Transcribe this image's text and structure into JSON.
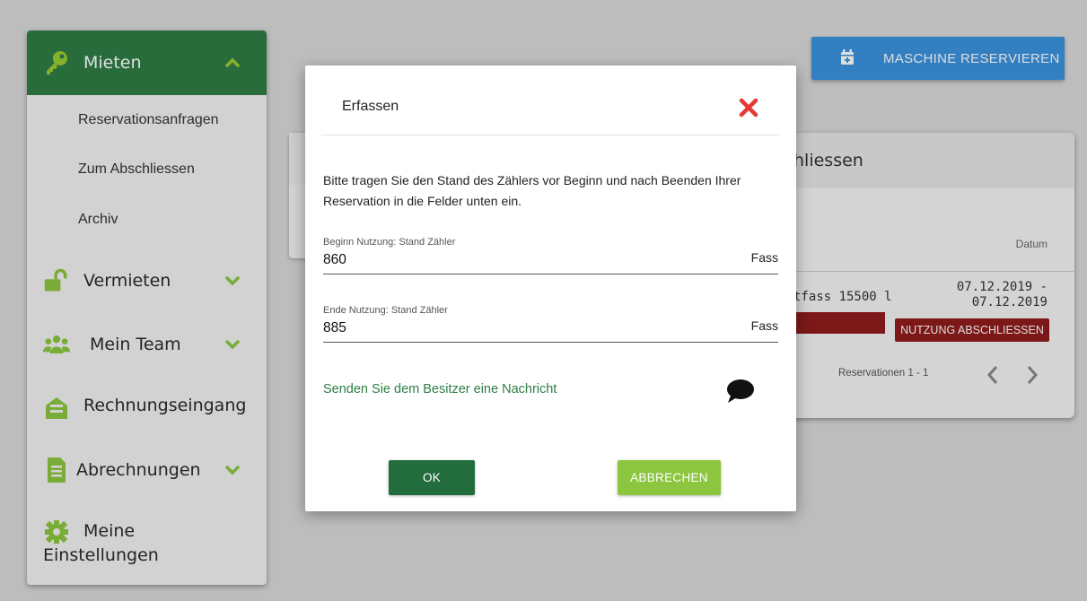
{
  "sidebar": {
    "mieten": {
      "label": "Mieten",
      "icon": "key-icon"
    },
    "mieten_sub": [
      {
        "label": "Reservationsanfragen"
      },
      {
        "label": "Zum Abschliessen"
      },
      {
        "label": "Archiv"
      }
    ],
    "vermieten": {
      "label": "Vermieten",
      "icon": "unlock-icon"
    },
    "team": {
      "label": "Mein Team",
      "icon": "users-icon"
    },
    "rechnung": {
      "label": "Rechnungseingang",
      "icon": "envelope-icon"
    },
    "abrechnungen": {
      "label": "Abrechnungen",
      "icon": "document-icon"
    },
    "einstellungen": {
      "label_line1": "Meine",
      "label_line2": "Einstellungen",
      "icon": "gear-icon"
    }
  },
  "header": {
    "reserve_button": "MASCHINE RESERVIEREN"
  },
  "card": {
    "title": "hliessen",
    "datum_header": "Datum",
    "machine": "tfass 15500 l",
    "date_from": "07.12.2019 -",
    "date_to": "07.12.2019",
    "finish_button": "NUTZUNG ABSCHLIESSEN",
    "pagination": "Reservationen 1 - 1"
  },
  "modal": {
    "title": "Erfassen",
    "intro": "Bitte tragen Sie den Stand des Zählers vor Beginn und nach Beenden Ihrer Reservation in die Felder unten ein.",
    "start": {
      "label": "Beginn Nutzung: Stand Zähler",
      "value": "860",
      "unit": "Fass"
    },
    "end": {
      "label": "Ende Nutzung: Stand Zähler",
      "value": "885",
      "unit": "Fass"
    },
    "message_link": "Senden Sie dem Besitzer eine Nachricht",
    "ok": "OK",
    "cancel": "ABBRECHEN"
  },
  "colors": {
    "primary_green": "#2e7d46",
    "light_green": "#8cc63f",
    "danger_red": "#8f1c1c",
    "close_red": "#e53935",
    "blue": "#3a92de"
  }
}
